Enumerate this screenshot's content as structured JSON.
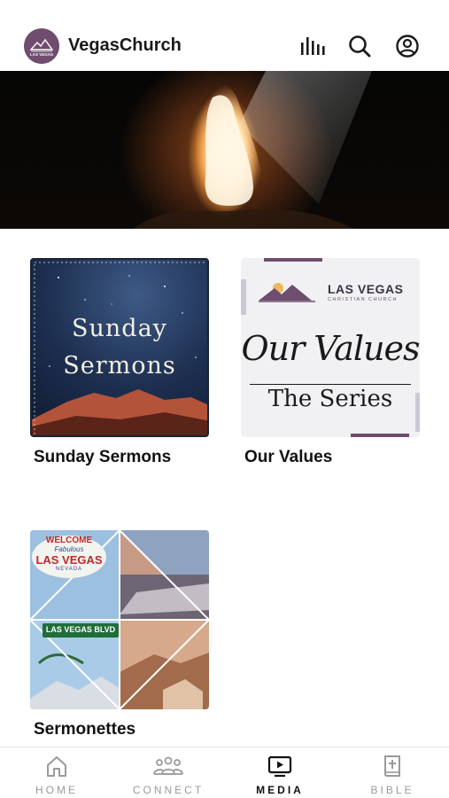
{
  "header": {
    "title": "VegasChurch",
    "logo_text": "LAS VEGAS",
    "icons": [
      "audio-bars-icon",
      "search-icon",
      "account-icon"
    ]
  },
  "hero": {
    "description": "cave opening with bright light"
  },
  "media": {
    "items": [
      {
        "label": "Sunday Sermons",
        "thumb_line1": "Sunday",
        "thumb_line2": "Sermons"
      },
      {
        "label": "Our Values",
        "brand_line1": "LAS VEGAS",
        "brand_line2": "CHRISTIAN CHURCH",
        "script_text": "Our Values",
        "subtitle": "The Series"
      },
      {
        "label": "Sermonettes",
        "sign_top": "WELCOME",
        "sign_fabulous": "Fabulous",
        "sign_main": "LAS VEGAS",
        "sign_nevada": "NEVADA",
        "street_sign": "LAS VEGAS BLVD"
      }
    ]
  },
  "bottom_nav": {
    "items": [
      {
        "label": "HOME",
        "icon": "home-icon",
        "active": false
      },
      {
        "label": "CONNECT",
        "icon": "people-icon",
        "active": false
      },
      {
        "label": "MEDIA",
        "icon": "tv-play-icon",
        "active": true
      },
      {
        "label": "BIBLE",
        "icon": "bible-icon",
        "active": false
      }
    ]
  },
  "colors": {
    "brand_purple": "#6e4d6e",
    "active_nav": "#111111",
    "inactive_nav": "#9a9a9a"
  }
}
